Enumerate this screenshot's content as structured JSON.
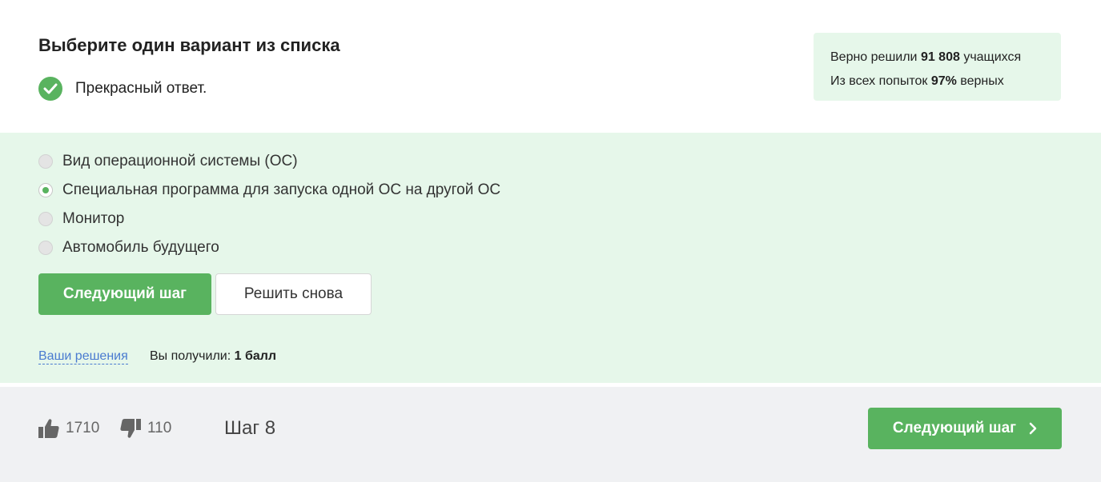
{
  "question": {
    "title": "Выберите один вариант из списка",
    "verdict": "Прекрасный ответ."
  },
  "stats": {
    "line1_prefix": "Верно решили ",
    "line1_value": "91 808",
    "line1_suffix": " учащихся",
    "line2_prefix": "Из всех попыток ",
    "line2_value": "97%",
    "line2_suffix": " верных"
  },
  "options": [
    {
      "label": "Вид операционной системы (ОС)",
      "selected": false
    },
    {
      "label": "Специальная программа для запуска одной ОС на другой ОС",
      "selected": true
    },
    {
      "label": "Монитор",
      "selected": false
    },
    {
      "label": "Автомобиль будущего",
      "selected": false
    }
  ],
  "actions": {
    "next_label": "Следующий шаг",
    "retry_label": "Решить снова"
  },
  "result": {
    "solutions_link": "Ваши решения",
    "score_prefix": "Вы получили: ",
    "score_value": "1 балл"
  },
  "footer": {
    "likes": "1710",
    "dislikes": "110",
    "step_label": "Шаг 8",
    "next_label": "Следующий шаг"
  },
  "colors": {
    "accent": "#59b35f",
    "answer_background": "#e6f7ea",
    "footer_background": "#f0f1f3",
    "link": "#4a7bd0"
  },
  "icons": [
    "check-circle-icon",
    "thumbs-up-icon",
    "thumbs-down-icon",
    "chevron-right-icon"
  ]
}
